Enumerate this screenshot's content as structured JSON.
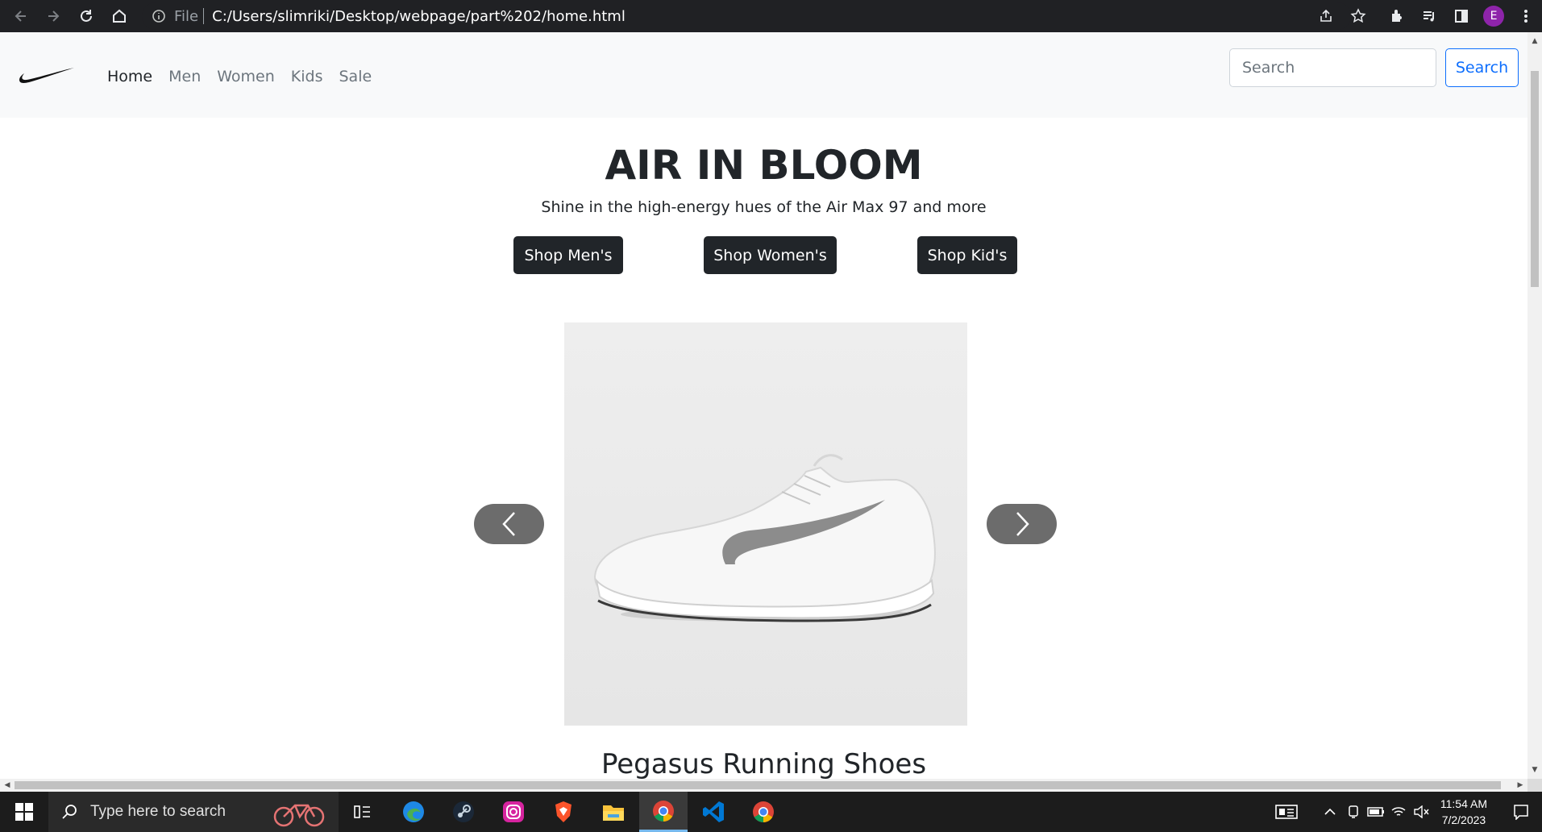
{
  "browser": {
    "url_scheme_label": "File",
    "url": "C:/Users/slimriki/Desktop/webpage/part%202/home.html",
    "profile_initial": "E",
    "icons": [
      "back-icon",
      "forward-icon",
      "reload-icon",
      "home-icon",
      "info-icon",
      "share-icon",
      "star-icon",
      "extensions-icon",
      "media-icon",
      "sidepanel-icon",
      "menu-icon"
    ]
  },
  "navbar": {
    "links": [
      {
        "label": "Home",
        "active": true
      },
      {
        "label": "Men",
        "active": false
      },
      {
        "label": "Women",
        "active": false
      },
      {
        "label": "Kids",
        "active": false
      },
      {
        "label": "Sale",
        "active": false
      }
    ],
    "search_placeholder": "Search",
    "search_button": "Search"
  },
  "hero": {
    "title": "AIR IN BLOOM",
    "subtitle": "Shine in the high-energy hues of the Air Max 97 and more",
    "buttons": [
      "Shop Men's",
      "Shop Women's",
      "Shop Kid's"
    ]
  },
  "carousel": {
    "product_name": "Pegasus Running Shoes"
  },
  "taskbar": {
    "search_placeholder": "Type here to search",
    "time": "11:54 AM",
    "date": "7/2/2023"
  },
  "colors": {
    "chrome_bg": "#202124",
    "navbar_bg": "#f8f9fa",
    "dark_button": "#212529",
    "accent_blue": "#0d6efd",
    "avatar": "#8e24aa"
  }
}
